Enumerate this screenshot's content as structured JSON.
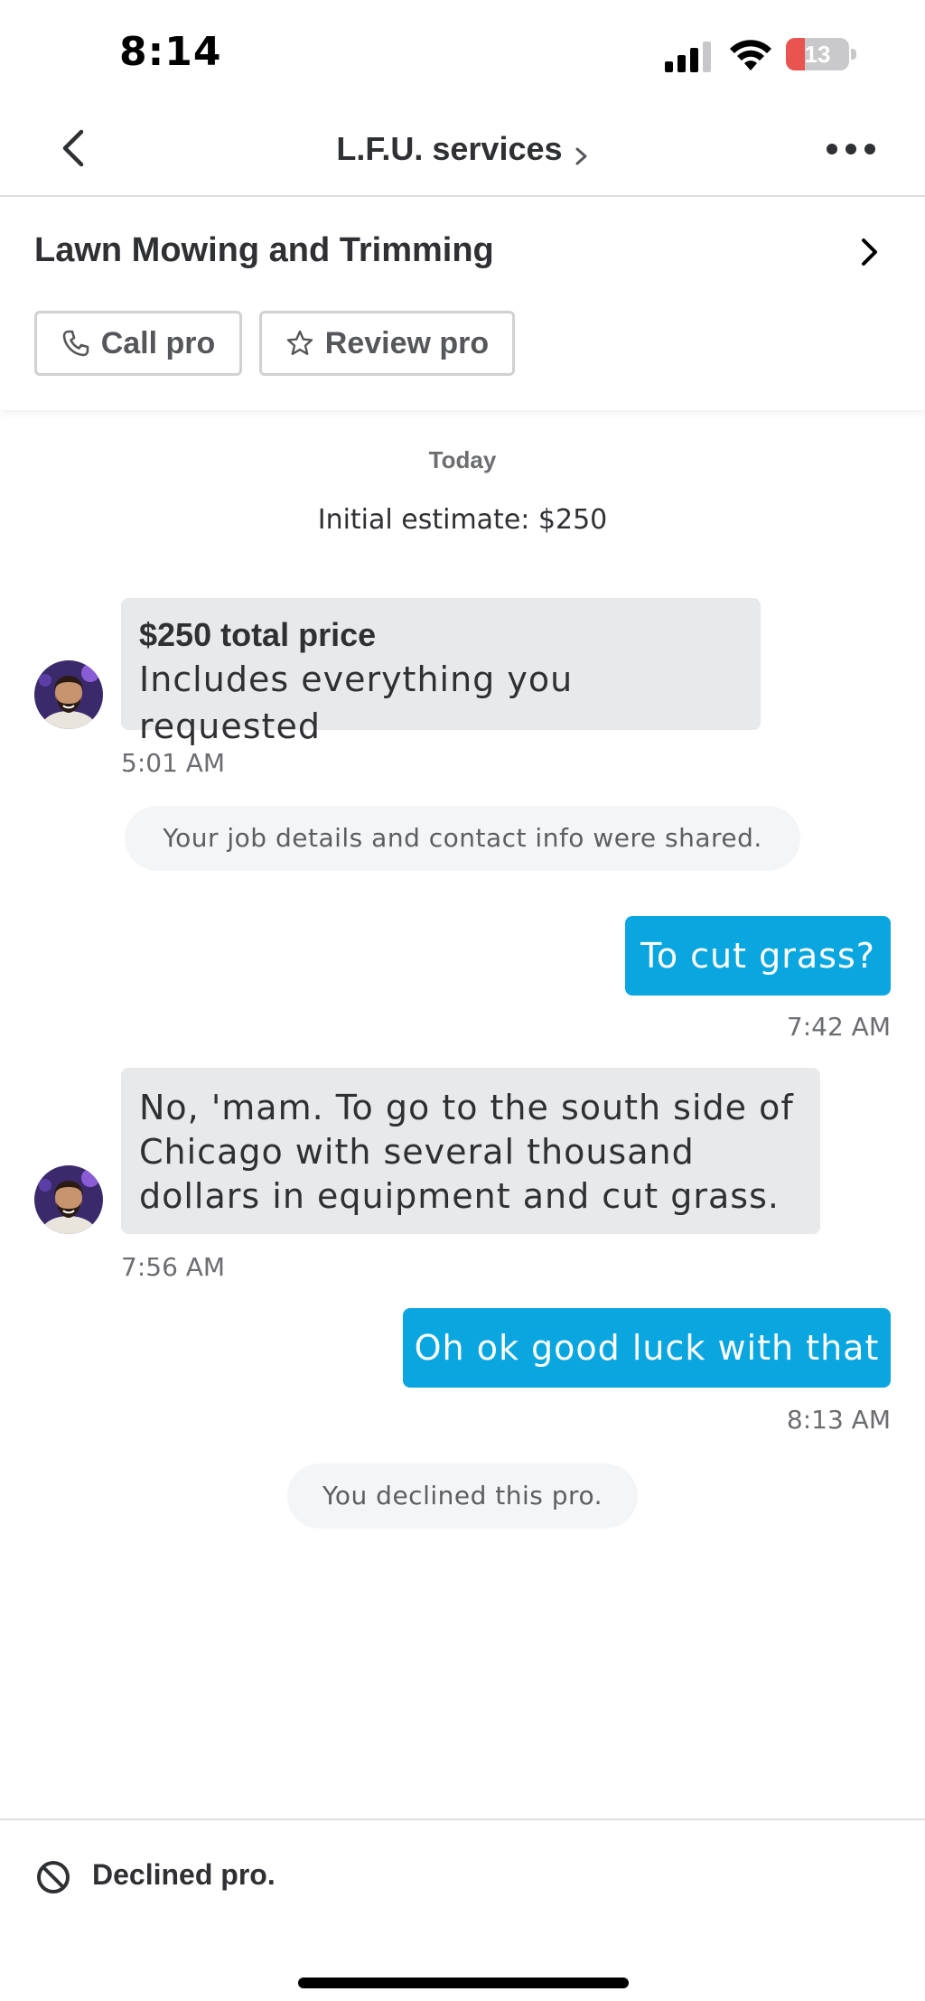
{
  "status_bar": {
    "time": "8:14",
    "battery_level": "13",
    "battery_fraction": 0.13,
    "signal_icon": "cellular-signal-icon",
    "wifi_icon": "wifi-icon"
  },
  "nav": {
    "title": "L.F.U. services",
    "back_icon": "chevron-left-icon",
    "more_icon": "more-horizontal-icon"
  },
  "job": {
    "title": "Lawn Mowing and Trimming",
    "call_label": "Call pro",
    "review_label": "Review pro"
  },
  "chat": {
    "day_label": "Today",
    "estimate": "Initial estimate: $250",
    "messages": [
      {
        "from": "pro",
        "title": "$250 total price",
        "text": "Includes everything you requested",
        "time": "5:01 AM"
      },
      {
        "from": "system",
        "text": "Your job details and contact info were shared."
      },
      {
        "from": "me",
        "text": "To cut grass?",
        "time": "7:42 AM"
      },
      {
        "from": "pro",
        "text": "No, 'mam. To go to the south side of Chicago with several thousand dollars in equipment and cut grass.",
        "time": "7:56 AM"
      },
      {
        "from": "me",
        "text": "Oh ok good luck with that",
        "time": "8:13 AM"
      },
      {
        "from": "system",
        "text": "You declined this pro."
      }
    ]
  },
  "footer": {
    "status_text": "Declined pro.",
    "icon": "ban-icon"
  },
  "colors": {
    "accent_blue": "#0aa6e0",
    "incoming_bubble": "#e8e9eb",
    "text_dark": "#2f3033",
    "battery_low": "#e9544f"
  }
}
